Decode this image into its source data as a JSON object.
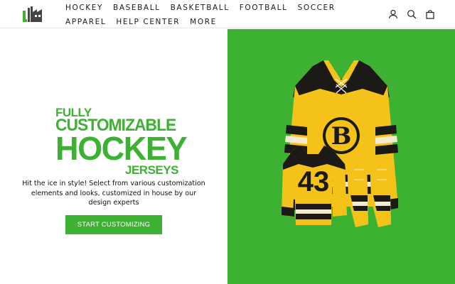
{
  "header": {
    "nav": [
      "HOCKEY",
      "BASEBALL",
      "BASKETBALL",
      "FOOTBALL",
      "SOCCER",
      "APPAREL",
      "HELP CENTER",
      "MORE"
    ],
    "icons": [
      "user-icon",
      "search-icon",
      "cart-icon"
    ],
    "logo": "jersey-factory-logo"
  },
  "hero": {
    "headline": {
      "line1": "FULLY",
      "line2": "CUSTOMIZABLE",
      "line3": "HOCKEY",
      "line4": "JERSEYS"
    },
    "description": "Hit the ice in style! Select from various customization elements and looks, customized in house by our design experts",
    "cta_label": "START CUSTOMIZING",
    "jersey_number": "43",
    "jersey_letter": "B"
  },
  "colors": {
    "brand_green": "#3cb132",
    "jersey_gold": "#f5c21a",
    "jersey_black": "#1c1a17",
    "stripe_cream": "#f3ead0"
  }
}
